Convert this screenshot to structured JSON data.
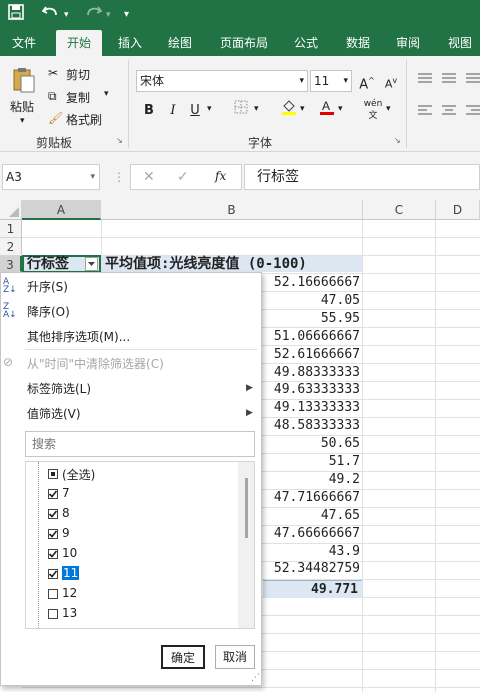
{
  "quick_access": {
    "save_icon": "save-icon",
    "undo_icon": "undo-icon",
    "redo_icon": "redo-icon",
    "customize_icon": "customize-icon"
  },
  "tabs": [
    "文件",
    "开始",
    "插入",
    "绘图",
    "页面布局",
    "公式",
    "数据",
    "审阅",
    "视图"
  ],
  "active_tab": "开始",
  "ribbon": {
    "clipboard": {
      "paste": "粘贴",
      "cut": "剪切",
      "copy": "复制",
      "format_painter": "格式刷",
      "group_label": "剪贴板"
    },
    "font": {
      "font_name": "宋体",
      "font_size": "11",
      "bold": "B",
      "italic": "I",
      "underline": "U",
      "group_label": "字体",
      "grow": "A",
      "shrink": "A",
      "phonetic": "wén"
    }
  },
  "formula_bar": {
    "name_box": "A3",
    "fx": "fx",
    "formula": "行标签"
  },
  "columns": [
    "A",
    "B",
    "C",
    "D"
  ],
  "rows": [
    "1",
    "2",
    "3"
  ],
  "pivot": {
    "row_label_header": "行标签",
    "value_header": "平均值项:光线亮度值 (0-100)",
    "values": [
      "52.16666667",
      "47.05",
      "55.95",
      "51.06666667",
      "52.61666667",
      "49.88333333",
      "49.63333333",
      "49.13333333",
      "48.58333333",
      "50.65",
      "51.7",
      "49.2",
      "47.71666667",
      "47.65",
      "47.66666667",
      "43.9",
      "52.34482759"
    ],
    "grand_total": "49.771"
  },
  "filter_menu": {
    "sort_asc": "升序(S)",
    "sort_desc": "降序(O)",
    "more_sort": "其他排序选项(M)...",
    "clear_filter": "从\"时间\"中清除筛选器(C)",
    "label_filter": "标签筛选(L)",
    "value_filter": "值筛选(V)",
    "search_placeholder": "搜索",
    "items": [
      {
        "label": "(全选)",
        "state": "partial"
      },
      {
        "label": "7",
        "state": "checked"
      },
      {
        "label": "8",
        "state": "checked"
      },
      {
        "label": "9",
        "state": "checked"
      },
      {
        "label": "10",
        "state": "checked"
      },
      {
        "label": "11",
        "state": "checked"
      },
      {
        "label": "12",
        "state": "unchecked"
      },
      {
        "label": "13",
        "state": "unchecked"
      }
    ],
    "ok": "确定",
    "cancel": "取消"
  },
  "colors": {
    "brand": "#217346",
    "selection": "#0078d7",
    "header_fill": "#dde7f1"
  }
}
